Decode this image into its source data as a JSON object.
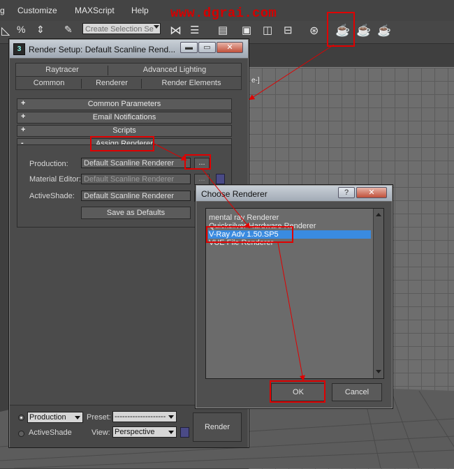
{
  "menubar": {
    "items": [
      "g",
      "Customize",
      "MAXScript",
      "Help"
    ],
    "watermark": "www.dgrai.com"
  },
  "toolbar": {
    "selection_set_placeholder": "Create Selection Se",
    "icons": [
      "select-region-icon",
      "percent-snap-icon",
      "spinner-snap-icon",
      "edit-named-selection-icon",
      "mirror-icon",
      "align-icon",
      "layer-manager-icon",
      "curve-editor-icon",
      "schematic-view-icon",
      "material-editor-icon",
      "render-setup-icon",
      "rendered-frame-window-icon",
      "render-production-icon",
      "render-iterative-icon"
    ]
  },
  "viewport": {
    "label": "e-]"
  },
  "render_setup": {
    "title": "Render Setup: Default Scanline Rend...",
    "window_buttons": [
      "▬",
      "▭",
      "✕"
    ],
    "tabs_row1": [
      "Raytracer",
      "Advanced Lighting"
    ],
    "tabs_row2": [
      "Common",
      "Renderer",
      "Render Elements"
    ],
    "rollouts": [
      {
        "sign": "+",
        "label": "Common Parameters"
      },
      {
        "sign": "+",
        "label": "Email Notifications"
      },
      {
        "sign": "+",
        "label": "Scripts"
      },
      {
        "sign": "-",
        "label": "Assign Renderer"
      }
    ],
    "assign": {
      "production_label": "Production:",
      "production_value": "Default Scanline Renderer",
      "material_editor_label": "Material Editor:",
      "material_editor_value": "Default Scanline Renderer",
      "activeshade_label": "ActiveShade:",
      "activeshade_value": "Default Scanline Renderer",
      "browse_label": "...",
      "save_defaults_label": "Save as Defaults"
    },
    "bottom": {
      "production_radio": "Production",
      "activeshade_radio": "ActiveShade",
      "preset_label": "Preset:",
      "preset_value": "--------------------",
      "view_label": "View:",
      "view_value": "Perspective",
      "render_label": "Render"
    }
  },
  "choose_renderer": {
    "title": "Choose Renderer",
    "help_label": "?",
    "close_label": "✕",
    "items": [
      "mental ray Renderer",
      "Quicksilver Hardware Renderer",
      "V-Ray Adv 1.50.SP5",
      "VUE File Renderer"
    ],
    "selected_index": 2,
    "ok_label": "OK",
    "cancel_label": "Cancel"
  },
  "colors": {
    "annotation": "#e00000",
    "selection": "#3a8be0",
    "panel": "#4b4b4b"
  }
}
